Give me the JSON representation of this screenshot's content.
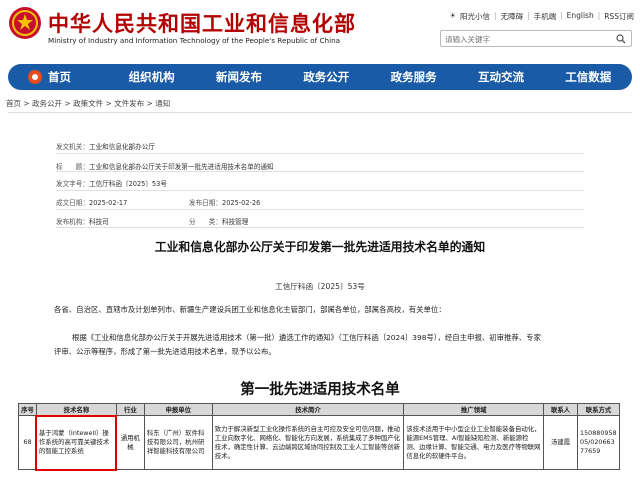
{
  "header": {
    "site_title": "中华人民共和国工业和信息化部",
    "site_subtitle": "Ministry of Industry and Information Technology of the People's Republic of China",
    "top_links": [
      "阳光小信",
      "无障碍",
      "手机端",
      "English",
      "RSS订阅"
    ],
    "search_placeholder": "请输入关键字",
    "brand_color": "#b30000"
  },
  "nav": {
    "items": [
      "首页",
      "组织机构",
      "新闻发布",
      "政务公开",
      "政务服务",
      "互动交流",
      "工信数据"
    ],
    "color": "#1a5ba8"
  },
  "breadcrumb": "首页 > 政务公开 > 政策文件 > 文件发布 > 通知",
  "meta": {
    "issuer_key": "发文机关：",
    "issuer_val": "工业和信息化部办公厅",
    "title_key": "标　　题：",
    "title_val": "工业和信息化部办公厅关于印发第一批先进适用技术名单的通知",
    "docno_key": "发文字号：",
    "docno_val": "工信厅科函〔2025〕53号",
    "date_key": "成文日期：",
    "date_val": "2025-02-17",
    "pub_key": "发布日期：",
    "pub_val": "2025-02-26",
    "dept_key": "发布机构：",
    "dept_val": "科技司",
    "cat_key": "分　　类：",
    "cat_val": "科技管理"
  },
  "doc": {
    "title": "工业和信息化部办公厅关于印发第一批先进适用技术名单的通知",
    "number": "工信厅科函〔2025〕53号",
    "recipients": "各省、自治区、直辖市及计划单列市、新疆生产建设兵团工业和信息化主管部门，部属各单位，部属各高校，有关单位：",
    "body_line1": "根据《工业和信息化部办公厅关于开展先进适用技术（第一批）遴选工作的通知》（工信厅科函〔2024〕398号），经自主申报、初审推荐、专家",
    "body_line2": "评审、公示等程序，形成了第一批先进适用技术名单，现予以公布。",
    "list_title": "第一批先进适用技术名单"
  },
  "table": {
    "headers": [
      "序号",
      "技术名称",
      "行业",
      "申报单位",
      "技术简介",
      "推广领域",
      "联系人",
      "联系方式"
    ],
    "row": {
      "no": "68",
      "name": "基于鸿蒙（Intewell）操作系统的高可靠关键技术的智能工控系统",
      "industry": "通用机械",
      "company": "科东（广州）软件科技有限公司，杭州研祥智能科技有限公司",
      "intro": "致力于解决新型工业化操作系统的自主可控及安全可信问题，推动工业向数字化、网络化、智能化方向发展，系统集成了多种国产化技术，确定性计算、云边端跨区域协同控制及工业人工智能等创新技术。",
      "field": "该技术适用于中小型企业工业智能装备自动化，能源EMS管理、AI智能缺陷检测、新能源检测、边缘计算、智能交通、电力及医疗等物联网信息化的软硬件平台。",
      "contact": "汤建霞",
      "phone": "15088095805/02066377659"
    }
  }
}
